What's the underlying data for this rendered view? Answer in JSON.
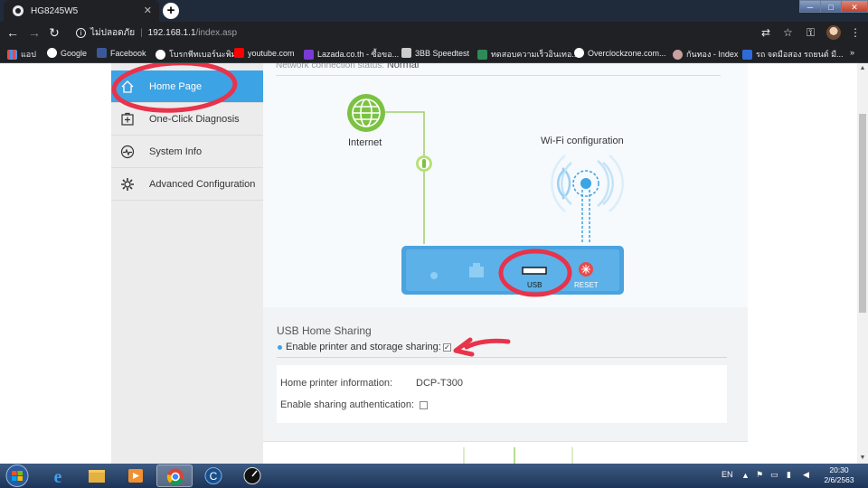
{
  "browser": {
    "tab_title": "HG8245W5",
    "tab_close": "✕",
    "new_tab": "+",
    "window_controls": {
      "minimize": "─",
      "maximize": "□",
      "close": "✕"
    },
    "nav": {
      "back": "←",
      "forward": "→",
      "reload": "↻"
    },
    "address": {
      "security_label": "ไม่ปลอดภัย",
      "host": "192.168.1.1",
      "path": "/index.asp"
    },
    "toolbar_icons": {
      "translate": "⇄",
      "star": "☆",
      "key": "⚿",
      "menu": "⋮"
    },
    "bookmarks": [
      {
        "label": "แอป",
        "color": "#e84a4a"
      },
      {
        "label": "Google",
        "color": "#ffffff"
      },
      {
        "label": "Facebook",
        "color": "#3b5998"
      },
      {
        "label": "โบรกพีทเบอร์นะพิมพ์",
        "color": "#ffffff"
      },
      {
        "label": "youtube.com",
        "color": "#ff0000"
      },
      {
        "label": "Lazada.co.th - ซื้อขอ...",
        "color": "#7b3ad6"
      },
      {
        "label": "3BB Speedtest",
        "color": "#cccccc"
      },
      {
        "label": "ทดสอบความเร็วอินเทอ...",
        "color": "#2e8b57"
      },
      {
        "label": "Overclockzone.com...",
        "color": "#ffffff"
      },
      {
        "label": "กันทอง - Index",
        "color": "#c9a0a0"
      },
      {
        "label": "รถ จดมือสอง รถยนต์ มื...",
        "color": "#2f6bd8"
      }
    ],
    "bookmarks_more": "»"
  },
  "sidebar": {
    "items": [
      {
        "label": "Home Page",
        "icon": "home-icon",
        "active": true
      },
      {
        "label": "One-Click Diagnosis",
        "icon": "diagnosis-icon",
        "active": false
      },
      {
        "label": "System Info",
        "icon": "pulse-icon",
        "active": false
      },
      {
        "label": "Advanced Configuration",
        "icon": "gear-icon",
        "active": false
      }
    ]
  },
  "topology": {
    "status_label": "Network connection status:",
    "status_value": "Normal",
    "internet_label": "Internet",
    "wifi_label": "Wi-Fi configuration",
    "usb_label": "USB",
    "reset_label": "RESET"
  },
  "usb_sharing": {
    "title": "USB Home Sharing",
    "enable_label": "Enable printer and storage sharing:",
    "enable_checked": true,
    "printer_label": "Home printer information:",
    "printer_value": "DCP-T300",
    "auth_label": "Enable sharing authentication:",
    "auth_checked": false
  },
  "taskbar": {
    "language": "EN",
    "time": "20:30",
    "date": "2/6/2563"
  },
  "colors": {
    "accent": "#3ca3e5",
    "annotation": "#e8334a",
    "internet_green": "#7cc242",
    "router_blue": "#4aa3df"
  }
}
